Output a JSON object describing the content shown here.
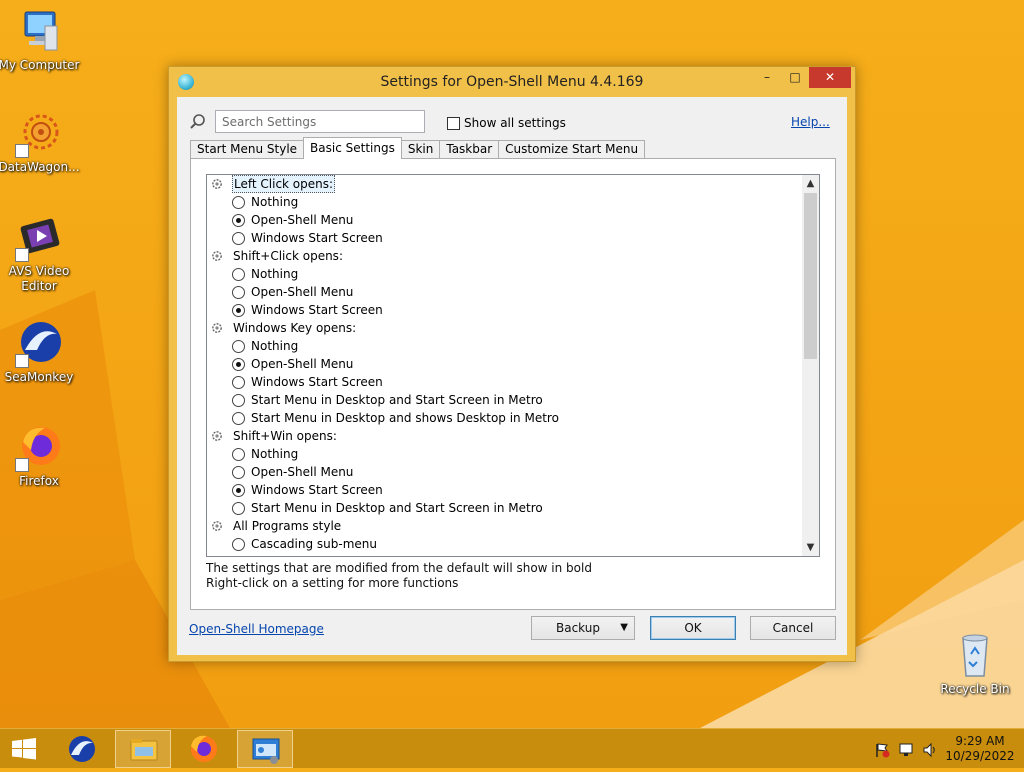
{
  "desktop": {
    "icons": [
      {
        "label": "My Computer"
      },
      {
        "label": "DataWagon..."
      },
      {
        "label": "AVS Video Editor"
      },
      {
        "label": "SeaMonkey"
      },
      {
        "label": "Firefox"
      },
      {
        "label": "Recycle Bin"
      }
    ]
  },
  "window": {
    "title": "Settings for Open-Shell Menu 4.4.169",
    "search": {
      "placeholder": "Search Settings",
      "value": ""
    },
    "show_all_label": "Show all settings",
    "show_all_checked": false,
    "help_label": "Help...",
    "tabs": [
      {
        "label": "Start Menu Style",
        "active": false
      },
      {
        "label": "Basic Settings",
        "active": true
      },
      {
        "label": "Skin",
        "active": false
      },
      {
        "label": "Taskbar",
        "active": false
      },
      {
        "label": "Customize Start Menu",
        "active": false
      }
    ],
    "settings": [
      {
        "group": "Left Click opens:",
        "selected": true,
        "options": [
          {
            "label": "Nothing",
            "checked": false
          },
          {
            "label": "Open-Shell Menu",
            "checked": true
          },
          {
            "label": "Windows Start Screen",
            "checked": false
          }
        ]
      },
      {
        "group": "Shift+Click opens:",
        "options": [
          {
            "label": "Nothing",
            "checked": false
          },
          {
            "label": "Open-Shell Menu",
            "checked": false
          },
          {
            "label": "Windows Start Screen",
            "checked": true
          }
        ]
      },
      {
        "group": "Windows Key opens:",
        "options": [
          {
            "label": "Nothing",
            "checked": false
          },
          {
            "label": "Open-Shell Menu",
            "checked": true
          },
          {
            "label": "Windows Start Screen",
            "checked": false
          },
          {
            "label": "Start Menu in Desktop and Start Screen in Metro",
            "checked": false
          },
          {
            "label": "Start Menu in Desktop and shows Desktop in Metro",
            "checked": false
          }
        ]
      },
      {
        "group": "Shift+Win opens:",
        "options": [
          {
            "label": "Nothing",
            "checked": false
          },
          {
            "label": "Open-Shell Menu",
            "checked": false
          },
          {
            "label": "Windows Start Screen",
            "checked": true
          },
          {
            "label": "Start Menu in Desktop and Start Screen in Metro",
            "checked": false
          }
        ]
      },
      {
        "group": "All Programs style",
        "options": [
          {
            "label": "Cascading sub-menu",
            "checked": false
          }
        ]
      }
    ],
    "hint_line1": "The settings that are modified from the default will show in bold",
    "hint_line2": "Right-click on a setting for more functions",
    "homepage_label": "Open-Shell Homepage",
    "buttons": {
      "backup": "Backup",
      "ok": "OK",
      "cancel": "Cancel"
    }
  },
  "taskbar": {
    "time": "9:29 AM",
    "date": "10/29/2022"
  },
  "colors": {
    "wallpaper": "#f3a414",
    "window_frame": "#f1c048",
    "close_button": "#c7392c",
    "link": "#0645ad"
  }
}
